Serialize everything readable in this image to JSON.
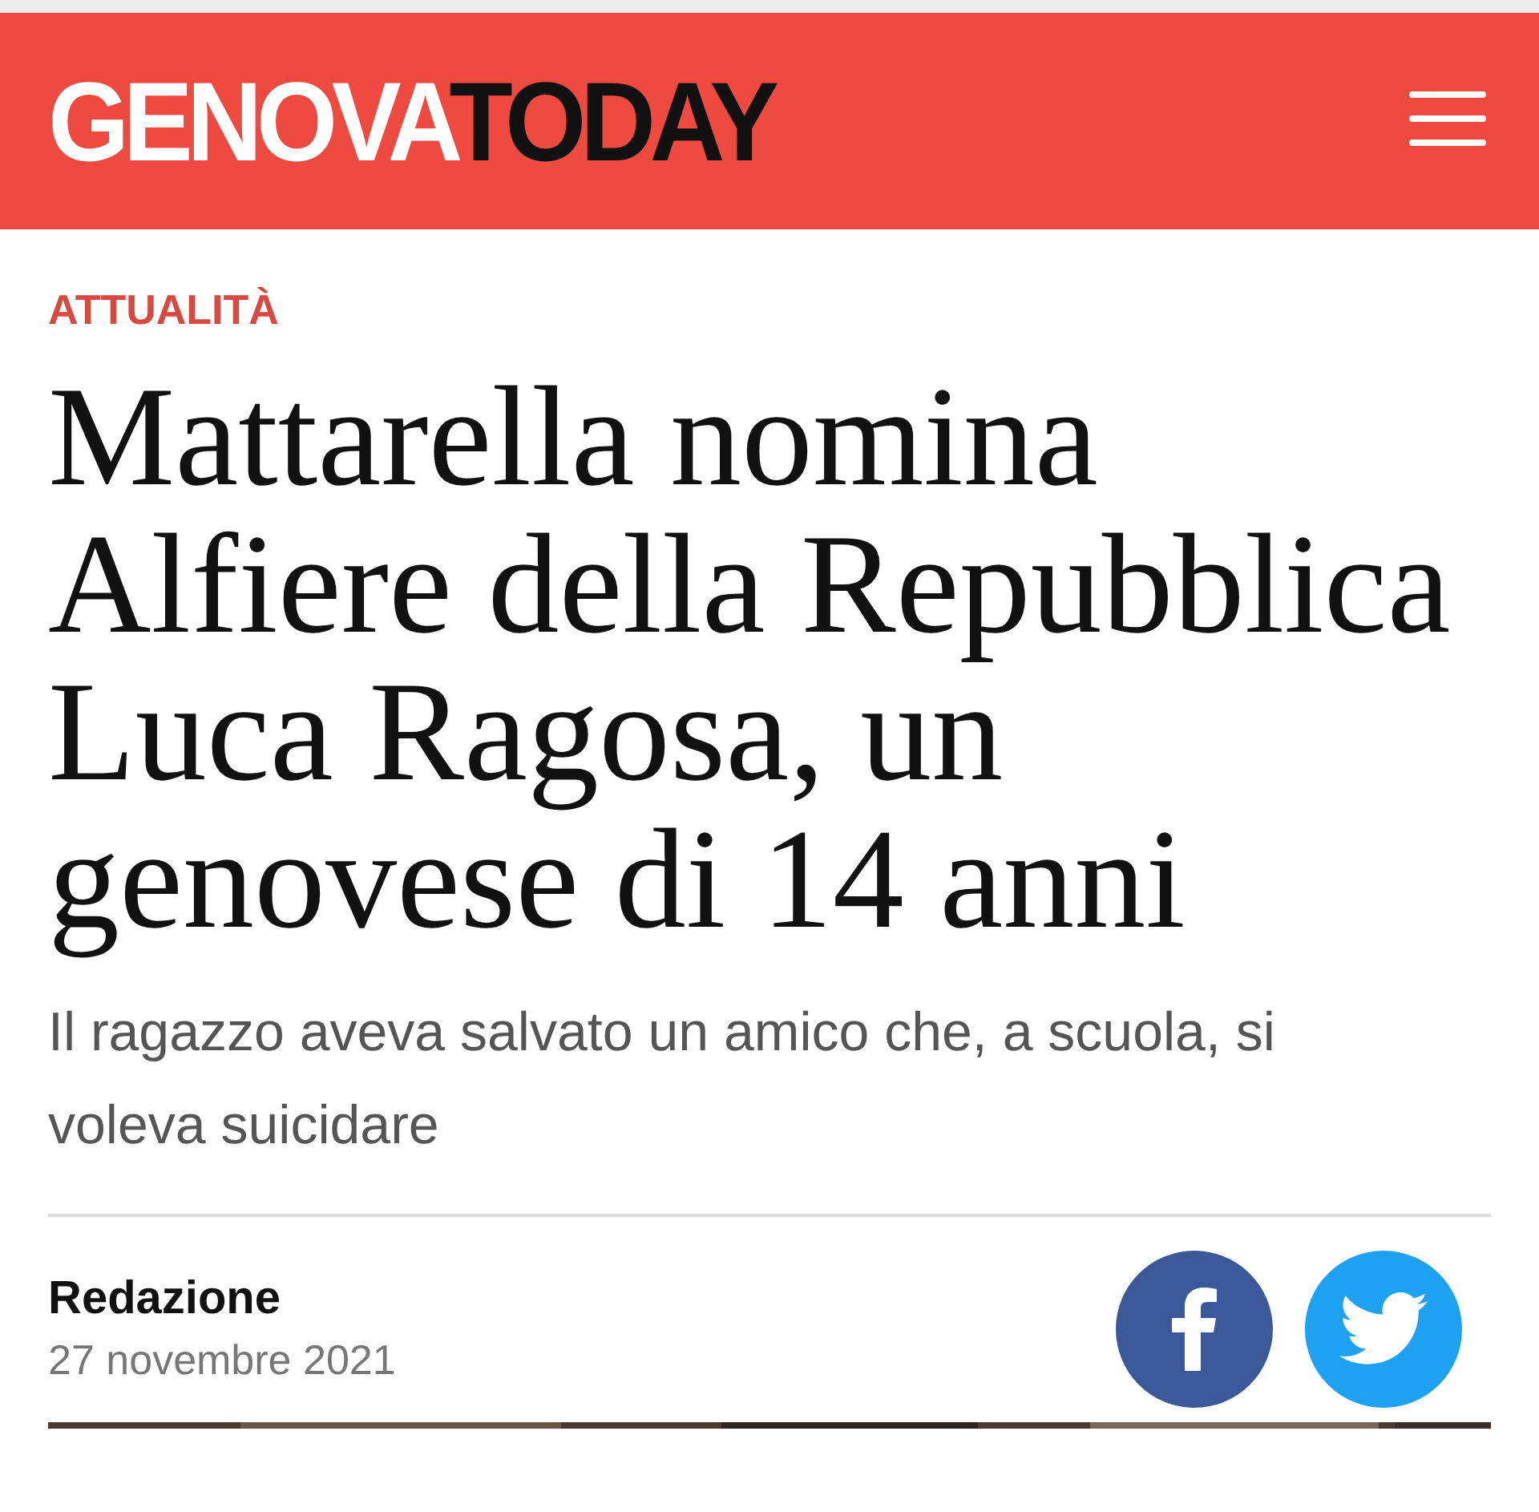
{
  "header": {
    "logo": {
      "part_1": "GENOVA",
      "part_2": "TODAY"
    }
  },
  "article": {
    "category": "ATTUALITÀ",
    "headline": "Mattarella nomina Alfiere della Repubblica Luca Ragosa, un genovese di 14 anni",
    "subtitle": "Il ragazzo aveva salvato un amico che, a scuola, si voleva suicidare",
    "author": "Redazione",
    "date": "27 novembre 2021",
    "share_buttons": [
      {
        "kind": "facebook"
      },
      {
        "kind": "twitter"
      }
    ]
  }
}
